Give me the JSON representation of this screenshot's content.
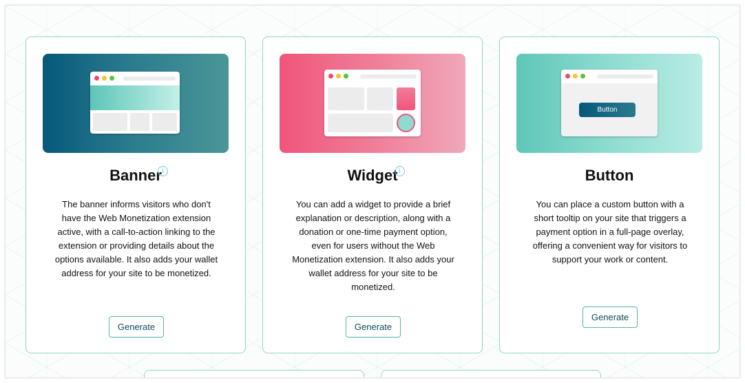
{
  "cards": [
    {
      "title": "Banner",
      "description": "The banner informs visitors who don't have the Web Monetization extension active, with a call-to-action linking to the extension or providing details about the options available. It also adds your wallet address for your site to be monetized.",
      "button_label": "Generate",
      "has_info": true,
      "info_glyph": "i",
      "gradient": [
        "#06587a",
        "#4a9697"
      ]
    },
    {
      "title": "Widget",
      "description": "You can add a widget to provide a brief explanation or description, along with a donation or one-time payment option, even for users without the Web Monetization extension. It also adds your wallet address for your site to be monetized.",
      "button_label": "Generate",
      "has_info": true,
      "info_glyph": "i",
      "gradient": [
        "#f0557a",
        "#f0a8ba"
      ]
    },
    {
      "title": "Button",
      "description": "You can place a custom button with a short tooltip on your site that triggers a payment option in a full-page overlay, offering a convenient way for visitors to support your work or content.",
      "button_label": "Generate",
      "has_info": false,
      "preview_button_label": "Button",
      "gradient": [
        "#5ec6b8",
        "#b9ece4"
      ]
    }
  ],
  "colors": {
    "card_border": "#8fd5c6",
    "button_border": "#4fb5a5",
    "info_icon": "#7cc7e6"
  }
}
